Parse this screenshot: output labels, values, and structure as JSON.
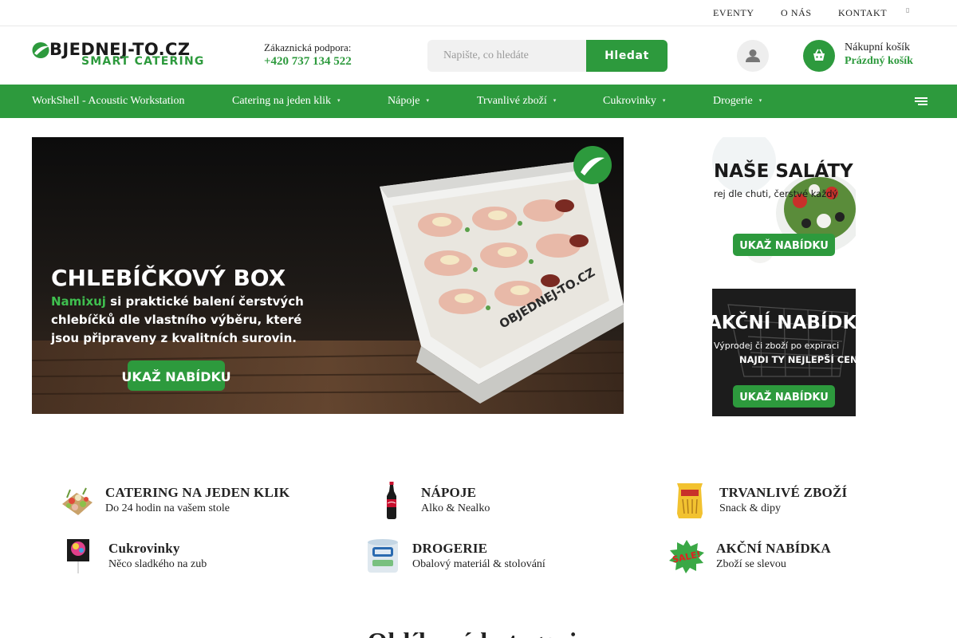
{
  "topbar": {
    "links": [
      "EVENTY",
      "O NÁS",
      "KONTAKT"
    ]
  },
  "logo": {
    "line1": "BJEDNEJ-TO.CZ",
    "line2": "SMART CATERING"
  },
  "support": {
    "label": "Zákaznická podpora:",
    "phone": "+420 737 134 522"
  },
  "search": {
    "placeholder": "Napište, co hledáte",
    "button": "Hledat"
  },
  "cart": {
    "label": "Nákupní košík",
    "status": "Prázdný košík"
  },
  "nav": {
    "items": [
      "WorkShell - Acoustic Workstation",
      "Catering na jeden klik",
      "Nápoje",
      "Trvanlivé zboží",
      "Cukrovinky",
      "Drogerie"
    ]
  },
  "hero": {
    "title": "CHLEBÍČKOVÝ BOX",
    "highlight": "Namixuj",
    "text1": " si praktické balení čerstvých",
    "text2": "chlebíčků dle vlastního výběru, které",
    "text3": "jsou připraveny z kvalitních surovin.",
    "cta": "UKAŽ NABÍDKU",
    "box_brand": "OBJEDNEJ-TO.CZ"
  },
  "side_banners": [
    {
      "title": "NAŠE SALÁTY",
      "subtitle": "rej dle chuti, čerstvé každý",
      "cta": "UKAŽ NABÍDKU"
    },
    {
      "title": "AKČNÍ NABÍDKA",
      "subtitle1": "Výprodej či zboží po expiraci",
      "subtitle2": "NAJDI TY NEJLEPŠÍ CENY !",
      "cta": "UKAŽ NABÍDKU"
    }
  ],
  "categories": [
    {
      "title": "CATERING NA JEDEN KLIK",
      "subtitle": "Do 24 hodin na vašem stole",
      "icon": "catering-platter-icon"
    },
    {
      "title": "NÁPOJE",
      "subtitle": "Alko & Nealko",
      "icon": "cola-bottle-icon"
    },
    {
      "title": "TRVANLIVÉ ZBOŽÍ",
      "subtitle": "Snack & dipy",
      "icon": "snack-bag-icon"
    },
    {
      "title": "Cukrovinky",
      "subtitle": "Něco sladkého na zub",
      "icon": "lollipop-icon"
    },
    {
      "title": "DROGERIE",
      "subtitle": "Obalový materiál & stolování",
      "icon": "paper-towel-icon"
    },
    {
      "title": "AKČNÍ NABÍDKA",
      "subtitle": "Zboží se slevou",
      "icon": "sale-badge-icon"
    }
  ],
  "section": {
    "heading": "Oblíbené kategorie"
  },
  "colors": {
    "brand_green": "#2d9a3d",
    "dark_text": "#222222",
    "light_gray": "#f1f1f1"
  }
}
